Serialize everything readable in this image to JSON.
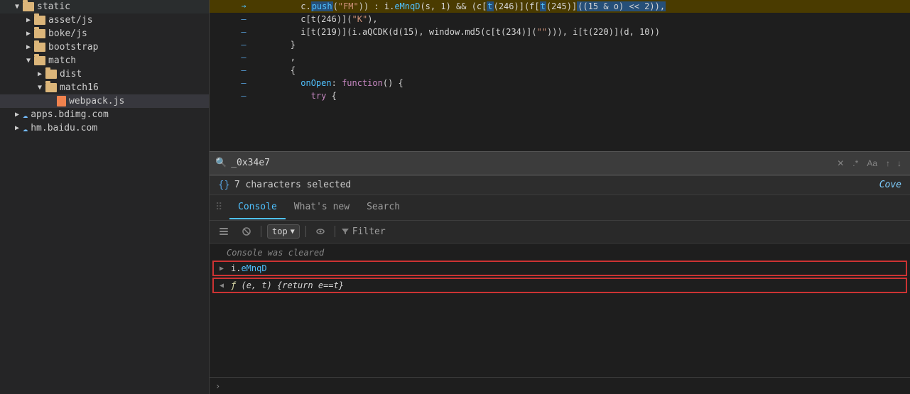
{
  "sidebar": {
    "items": [
      {
        "label": "static",
        "type": "folder",
        "indent": 0,
        "expanded": true
      },
      {
        "label": "asset/js",
        "type": "folder",
        "indent": 1,
        "expanded": false
      },
      {
        "label": "boke/js",
        "type": "folder",
        "indent": 1,
        "expanded": false
      },
      {
        "label": "bootstrap",
        "type": "folder",
        "indent": 1,
        "expanded": false
      },
      {
        "label": "match",
        "type": "folder",
        "indent": 1,
        "expanded": true
      },
      {
        "label": "dist",
        "type": "folder",
        "indent": 2,
        "expanded": false
      },
      {
        "label": "match16",
        "type": "folder",
        "indent": 2,
        "expanded": true
      },
      {
        "label": "webpack.js",
        "type": "file",
        "indent": 3,
        "expanded": false
      },
      {
        "label": "apps.bdimg.com",
        "type": "cloud",
        "indent": 0,
        "expanded": false
      },
      {
        "label": "hm.baidu.com",
        "type": "cloud",
        "indent": 0,
        "expanded": false
      }
    ]
  },
  "code": {
    "lines": [
      {
        "num": "",
        "arrow": "→",
        "highlighted": true,
        "content": "c.push(\"FM\")) : i.eMnqD(s, 1) && (c[t(246)](f[t(245)]((15 & o) << 2)),"
      },
      {
        "num": "",
        "arrow": "",
        "highlighted": false,
        "content": "c[t(246)](\"K\"),"
      },
      {
        "num": "",
        "arrow": "",
        "highlighted": false,
        "content": "i[t(219)](i.aQCDK(d(15), window.md5(c[t(234)](\"\"»), i[t(220)](d, 10))"
      },
      {
        "num": "",
        "arrow": "",
        "highlighted": false,
        "content": "}"
      },
      {
        "num": "",
        "arrow": "",
        "highlighted": false,
        "content": ","
      },
      {
        "num": "",
        "arrow": "",
        "highlighted": false,
        "content": "{"
      },
      {
        "num": "",
        "arrow": "",
        "highlighted": false,
        "content": "onOpen: function() {"
      },
      {
        "num": "",
        "arrow": "",
        "highlighted": false,
        "content": "try {"
      }
    ]
  },
  "search": {
    "query": "_0x34e7",
    "placeholder": "Search",
    "clear_label": "✕",
    "regex_label": ".*",
    "case_label": "Aa",
    "prev_label": "↑",
    "next_label": "↓"
  },
  "status": {
    "chars_selected": "7 characters selected",
    "coverage_label": "Cove"
  },
  "devtools": {
    "tabs": [
      {
        "label": "Console",
        "active": true
      },
      {
        "label": "What's new",
        "active": false
      },
      {
        "label": "Search",
        "active": false
      }
    ]
  },
  "console_toolbar": {
    "top_label": "top",
    "filter_label": "Filter"
  },
  "console": {
    "cleared_msg": "Console was cleared",
    "rows": [
      {
        "arrow": "▶",
        "content_parts": [
          {
            "text": "i.",
            "class": "c-white"
          },
          {
            "text": "eMnqD",
            "class": "c-blue"
          }
        ]
      },
      {
        "arrow": "◀",
        "content_parts": [
          {
            "text": "ƒ",
            "class": "c-yellow"
          },
          {
            "text": " (e, t) {return e==t}",
            "class": "c-white c-italic"
          }
        ]
      }
    ]
  }
}
